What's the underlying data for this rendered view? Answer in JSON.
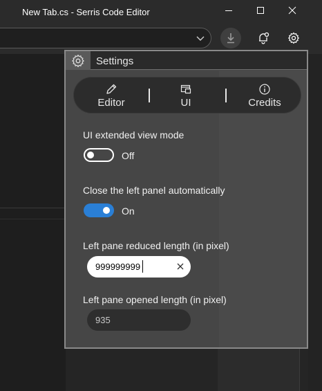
{
  "window": {
    "title": "New Tab.cs - Serris Code Editor"
  },
  "toolbar": {
    "address_value": "",
    "icons": [
      "chevron-down-icon",
      "download-icon",
      "notification-icon",
      "gear-icon"
    ]
  },
  "settings": {
    "title": "Settings",
    "tabs": [
      {
        "label": "Editor",
        "icon": "pencil-icon"
      },
      {
        "label": "UI",
        "icon": "window-icon"
      },
      {
        "label": "Credits",
        "icon": "info-icon"
      }
    ],
    "items": {
      "extended_view": {
        "label": "UI extended view mode",
        "state_text": "Off",
        "on": false
      },
      "auto_close": {
        "label": "Close the left panel automatically",
        "state_text": "On",
        "on": true
      },
      "reduced_length": {
        "label": "Left pane reduced length (in pixel)",
        "value": "999999999"
      },
      "opened_length": {
        "label": "Left pane opened length (in pixel)",
        "value": "935"
      }
    }
  },
  "colors": {
    "accent": "#2a7fd6",
    "panel": "#464646",
    "background": "#202020"
  }
}
